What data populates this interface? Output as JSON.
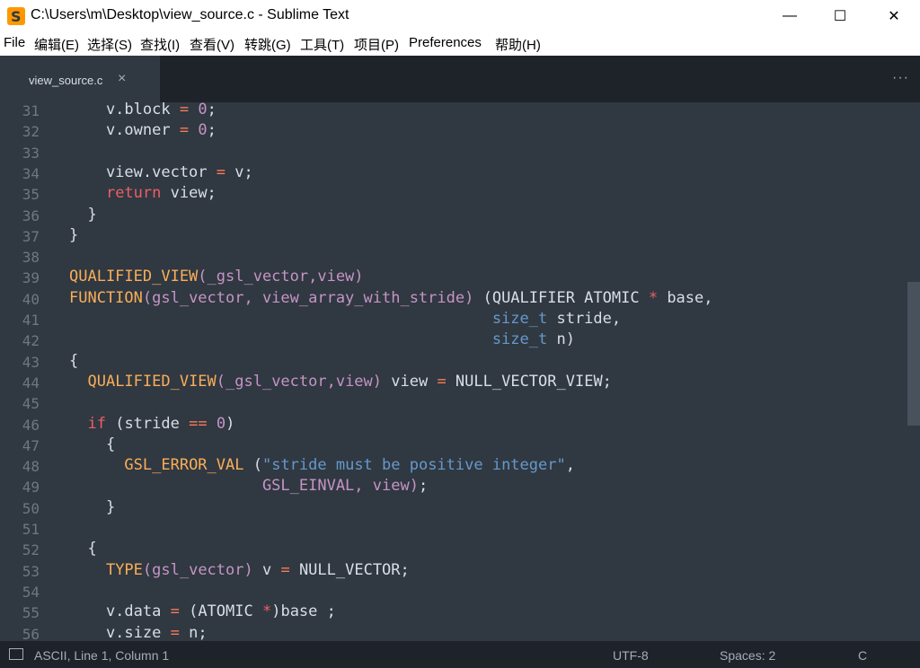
{
  "window": {
    "title": "C:\\Users\\m\\Desktop\\view_source.c - Sublime Text",
    "minimize": "—",
    "maximize": "☐",
    "close": "✕"
  },
  "menu": [
    "File",
    "编辑(E)",
    "选择(S)",
    "查找(I)",
    "查看(V)",
    "转跳(G)",
    "工具(T)",
    "项目(P)",
    "Preferences",
    "帮助(H)"
  ],
  "tabs": [
    {
      "label": "view_source.c",
      "close": "×"
    }
  ],
  "tab_overflow": "···",
  "lines": [
    {
      "n": "31",
      "code": "  v.block = 0;"
    },
    {
      "n": "32",
      "code": "  v.owner = 0;"
    },
    {
      "n": "33",
      "code": ""
    },
    {
      "n": "34",
      "code": "  view.vector = v;"
    },
    {
      "n": "35",
      "code": "  return view;"
    },
    {
      "n": "36",
      "code": " }"
    },
    {
      "n": "37",
      "code": "}"
    },
    {
      "n": "38",
      "code": ""
    },
    {
      "n": "39",
      "code": "QUALIFIED_VIEW(_gsl_vector,view)"
    },
    {
      "n": "40",
      "code": "FUNCTION(gsl_vector, view_array_with_stride) (QUALIFIER ATOMIC * base,"
    },
    {
      "n": "41",
      "code": "                         size_t stride,"
    },
    {
      "n": "42",
      "code": "                         size_t n)"
    },
    {
      "n": "43",
      "code": "{"
    },
    {
      "n": "44",
      "code": " QUALIFIED_VIEW(_gsl_vector,view) view = NULL_VECTOR_VIEW;"
    },
    {
      "n": "45",
      "code": ""
    },
    {
      "n": "46",
      "code": " if (stride == 0)"
    },
    {
      "n": "47",
      "code": "  {"
    },
    {
      "n": "48",
      "code": "   GSL_ERROR_VAL (\"stride must be positive integer\","
    },
    {
      "n": "49",
      "code": "          GSL_EINVAL, view);"
    },
    {
      "n": "50",
      "code": "  }"
    },
    {
      "n": "51",
      "code": ""
    },
    {
      "n": "52",
      "code": " {"
    },
    {
      "n": "53",
      "code": "  TYPE(gsl_vector) v = NULL_VECTOR;"
    },
    {
      "n": "54",
      "code": ""
    },
    {
      "n": "55",
      "code": "  v.data = (ATOMIC *)base ;"
    },
    {
      "n": "56",
      "code": "  v.size = n;"
    }
  ],
  "status": {
    "position": "ASCII, Line 1, Column 1",
    "encoding": "UTF-8",
    "indent": "Spaces: 2",
    "syntax": "C"
  },
  "colors": {
    "background": "#303841",
    "tab_bar": "#1d2329",
    "accent": "#f0a05a"
  }
}
